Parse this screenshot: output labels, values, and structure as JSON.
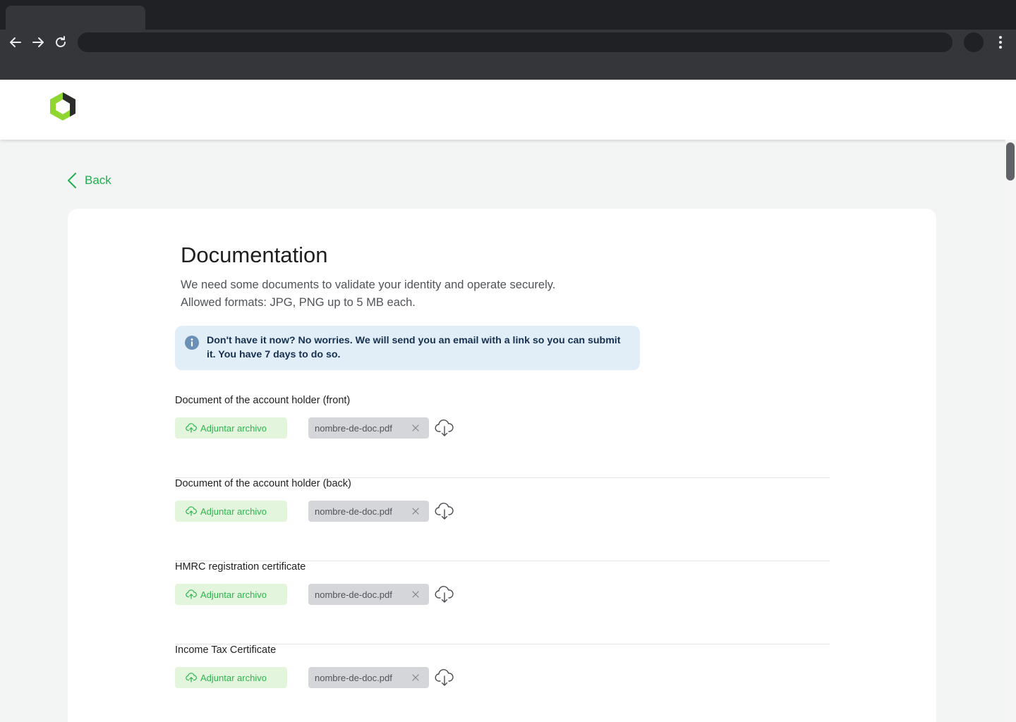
{
  "header": {
    "back_label": "Back"
  },
  "page": {
    "title": "Documentation",
    "description_line1": "We need some documents to validate your identity and operate securely.",
    "description_line2": "Allowed formats: JPG, PNG up to 5 MB each.",
    "info_message": "Don't have it now? No worries. We will send you an email with a link so you can submit it. You have 7 days to do so."
  },
  "documents": [
    {
      "label": "Document of the account holder (front)",
      "attach_label": "Adjuntar archivo",
      "file_name": "nombre-de-doc.pdf"
    },
    {
      "label": "Document of the account holder (back)",
      "attach_label": "Adjuntar archivo",
      "file_name": "nombre-de-doc.pdf"
    },
    {
      "label": "HMRC registration certificate",
      "attach_label": "Adjuntar archivo",
      "file_name": "nombre-de-doc.pdf"
    },
    {
      "label": "Income Tax Certificate",
      "attach_label": "Adjuntar archivo",
      "file_name": "nombre-de-doc.pdf"
    }
  ],
  "colors": {
    "accent_green": "#22ad4e",
    "attach_bg": "#e3f5dc",
    "info_bg": "#e1eef7",
    "info_text": "#163150",
    "chip_bg": "#d4d6d9"
  },
  "icons": {
    "back": "chevron-left-icon",
    "info": "info-icon",
    "attach": "cloud-upload-icon",
    "remove": "close-icon",
    "download": "cloud-download-icon"
  }
}
